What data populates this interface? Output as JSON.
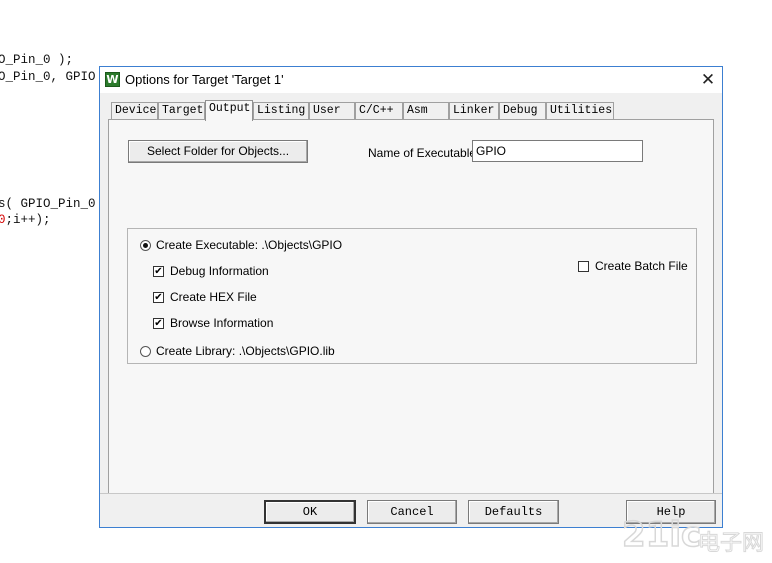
{
  "background_code": {
    "line1": "O_Pin_0 );",
    "line2": "O_Pin_0, GPIO",
    "line3": "s( GPIO_Pin_0",
    "line4a": "0",
    "line4b": ";i++);"
  },
  "dialog": {
    "title": "Options for Target 'Target 1'",
    "icon_letter": "W",
    "close_glyph": "✕"
  },
  "tabs": [
    {
      "label": "Device"
    },
    {
      "label": "Target"
    },
    {
      "label": "Output"
    },
    {
      "label": "Listing"
    },
    {
      "label": "User"
    },
    {
      "label": "C/C++"
    },
    {
      "label": "Asm"
    },
    {
      "label": "Linker"
    },
    {
      "label": "Debug"
    },
    {
      "label": "Utilities"
    }
  ],
  "output": {
    "select_folder_label": "Select Folder for Objects...",
    "name_exec_label": "Name of Executable:",
    "name_exec_value": "GPIO",
    "create_exec_label": "Create Executable:  .\\Objects\\GPIO",
    "debug_info_label": "Debug Information",
    "create_hex_label": "Create HEX File",
    "browse_info_label": "Browse Information",
    "create_lib_label": "Create Library:  .\\Objects\\GPIO.lib",
    "create_batch_label": "Create Batch File",
    "check_glyph": "✔"
  },
  "footer": {
    "ok": "OK",
    "cancel": "Cancel",
    "defaults": "Defaults",
    "help": "Help"
  },
  "watermark": {
    "text": "21ic",
    "sub": "电子网"
  },
  "colors": {
    "accent": "#3c7fd1",
    "code_number": "#d40000"
  }
}
